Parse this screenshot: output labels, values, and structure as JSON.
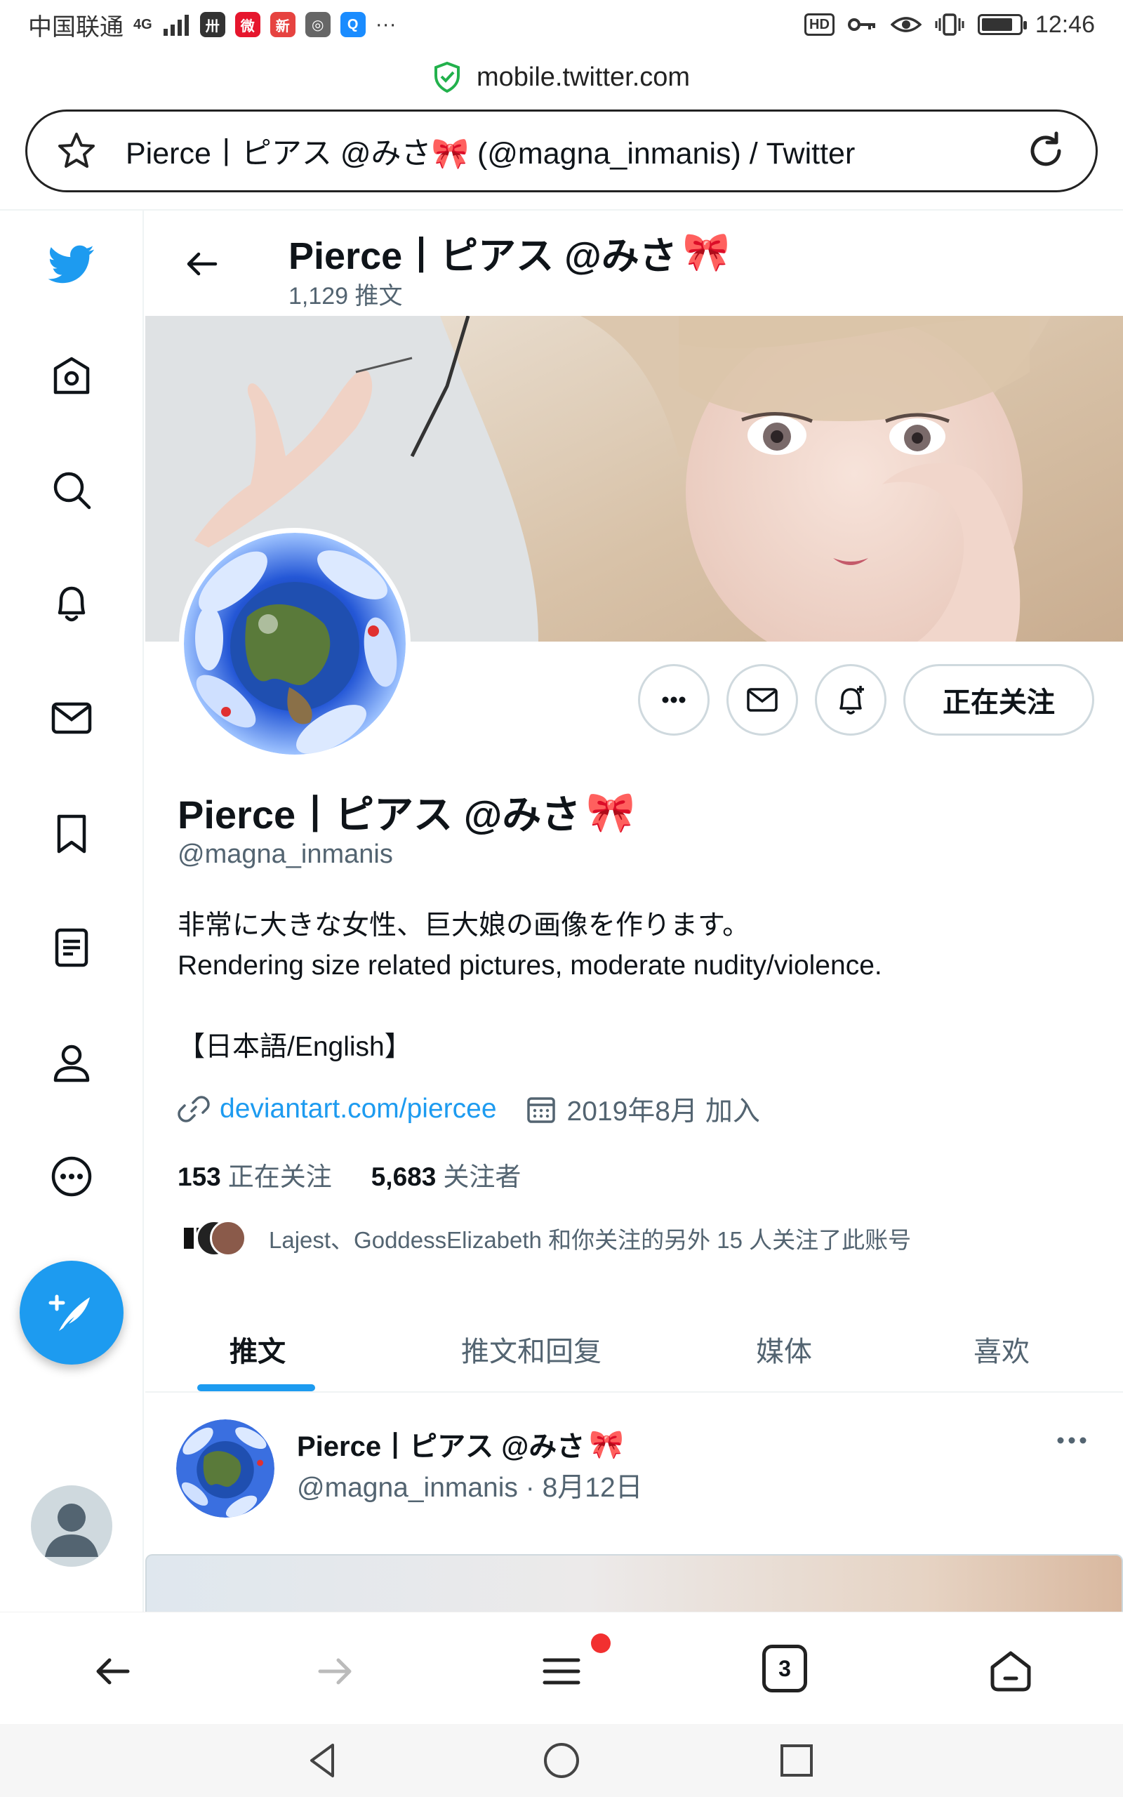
{
  "status_bar": {
    "carrier": "中国联通",
    "network": "4G",
    "time": "12:46",
    "battery_level": 0.85,
    "hd": "HD"
  },
  "browser": {
    "domain": "mobile.twitter.com",
    "page_title": "Pierce丨ピアス @みさ🎀 (@magna_inmanis) / Twitter",
    "open_tabs": "3"
  },
  "header": {
    "name": "Pierce丨ピアス @みさ",
    "bow": "🎀",
    "tweet_count": "1,129 推文"
  },
  "profile": {
    "name": "Pierce丨ピアス @みさ",
    "bow": "🎀",
    "handle": "@magna_inmanis",
    "bio_line1": "非常に大きな女性、巨大娘の画像を作ります。",
    "bio_line2": "Rendering size related pictures, moderate nudity/violence.",
    "bio_line3": "【日本語/English】",
    "link": "deviantart.com/piercee",
    "joined": "2019年8月 加入",
    "following_count": "153",
    "following_label": "正在关注",
    "followers_count": "5,683",
    "followers_label": "关注者",
    "followed_by": "Lajest、GoddessElizabeth 和你关注的另外 15 人关注了此账号",
    "follow_button": "正在关注"
  },
  "tabs": [
    {
      "label": "推文",
      "active": true
    },
    {
      "label": "推文和回复",
      "active": false
    },
    {
      "label": "媒体",
      "active": false
    },
    {
      "label": "喜欢",
      "active": false
    }
  ],
  "tweet": {
    "name": "Pierce丨ピアス @みさ",
    "bow": "🎀",
    "handle_date": "@magna_inmanis · 8月12日"
  },
  "colors": {
    "accent": "#1d9bf0",
    "text": "#0f1419",
    "secondary": "#536471",
    "border": "#cfd9de"
  }
}
